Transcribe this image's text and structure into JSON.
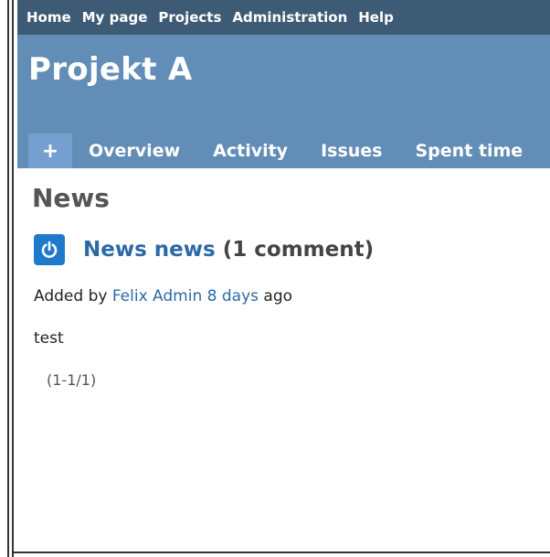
{
  "top_menu": {
    "items": [
      "Home",
      "My page",
      "Projects",
      "Administration",
      "Help"
    ]
  },
  "header": {
    "project_title": "Projekt A",
    "tabs": {
      "add_label": "+",
      "items": [
        "Overview",
        "Activity",
        "Issues",
        "Spent time"
      ]
    }
  },
  "main": {
    "page_title": "News",
    "news_item": {
      "icon": "power-icon",
      "title": "News news",
      "comments_label": "(1 comment)",
      "added_prefix": "Added by",
      "author": "Felix Admin",
      "age": "8 days",
      "age_suffix": "ago",
      "body": "test"
    },
    "pagination": "(1-1/1)"
  },
  "colors": {
    "top_menu_bg": "#3e5b76",
    "header_bg": "#628db6",
    "tab_add_bg": "#759fcf",
    "link": "#2c6aa6",
    "icon_bg": "#1f7acb"
  }
}
